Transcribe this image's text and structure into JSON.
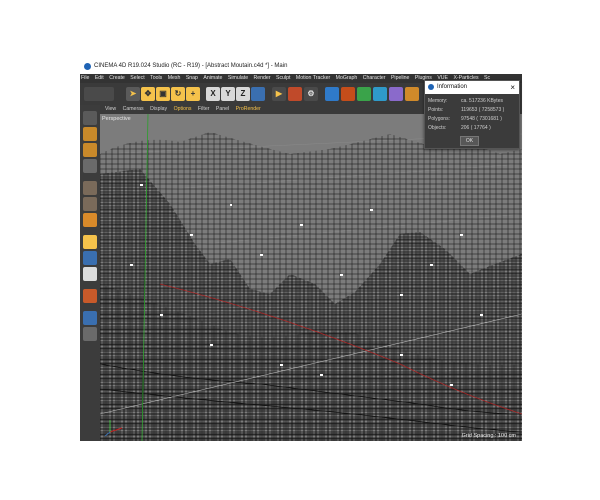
{
  "window": {
    "title": "CINEMA 4D R19.024 Studio (RC - R19) - [Abstract Moutain.c4d *] - Main"
  },
  "menubar": [
    "File",
    "Edit",
    "Create",
    "Select",
    "Tools",
    "Mesh",
    "Snap",
    "Animate",
    "Simulate",
    "Render",
    "Sculpt",
    "Motion Tracker",
    "MoGraph",
    "Character",
    "Pipeline",
    "Plugins",
    "VUE",
    "X-Particles",
    "Sc"
  ],
  "toolbar": {
    "axis_x": "X",
    "axis_y": "Y",
    "axis_z": "Z"
  },
  "viewport": {
    "menu": [
      "View",
      "Cameras",
      "Display",
      "Options",
      "Filter",
      "Panel",
      "ProRender"
    ],
    "camera_label": "Perspective",
    "grid_spacing": "Grid Spacing : 100 cm"
  },
  "info_dialog": {
    "title": "Information",
    "close": "×",
    "rows": [
      {
        "label": "Memory:",
        "value": "ca. 517236 KBytes"
      },
      {
        "label": "Points:",
        "value": "119653 ( 7258573 )"
      },
      {
        "label": "Polygons:",
        "value": "97548 ( 7301681 )"
      },
      {
        "label": "Objects:",
        "value": "206 ( 17764 )"
      }
    ],
    "ok_label": "OK"
  },
  "colors": {
    "accent": "#f5c24b",
    "wire": "#111111",
    "x_axis": "#c02020",
    "y_axis": "#2aa02a"
  }
}
